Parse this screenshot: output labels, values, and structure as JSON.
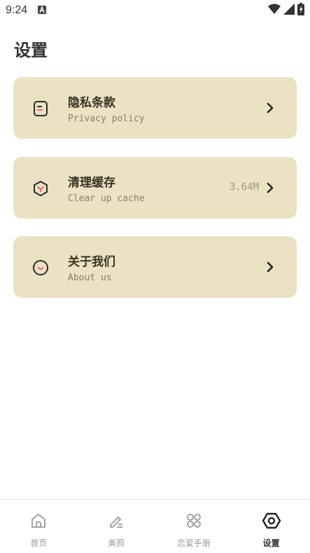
{
  "status_bar": {
    "time": "9:24"
  },
  "page": {
    "title": "设置"
  },
  "settings": [
    {
      "title": "隐私条款",
      "subtitle": "Privacy policy",
      "value": "",
      "icon": "document-icon"
    },
    {
      "title": "清理缓存",
      "subtitle": "Clear up cache",
      "value": "3.64M",
      "icon": "broom-icon"
    },
    {
      "title": "关于我们",
      "subtitle": "About us",
      "value": "",
      "icon": "smile-icon"
    }
  ],
  "bottom_nav": {
    "items": [
      {
        "label": "首页",
        "icon": "home-icon",
        "active": false
      },
      {
        "label": "美照",
        "icon": "pen-icon",
        "active": false
      },
      {
        "label": "恋爱手册",
        "icon": "grid-icon",
        "active": false
      },
      {
        "label": "设置",
        "icon": "hexagon-settings-icon",
        "active": true
      }
    ]
  },
  "colors": {
    "card_bg": "#ebe2c4",
    "accent_pink": "#e8677b",
    "text_dark": "#3a3324",
    "text_muted": "#8a7f6a"
  }
}
